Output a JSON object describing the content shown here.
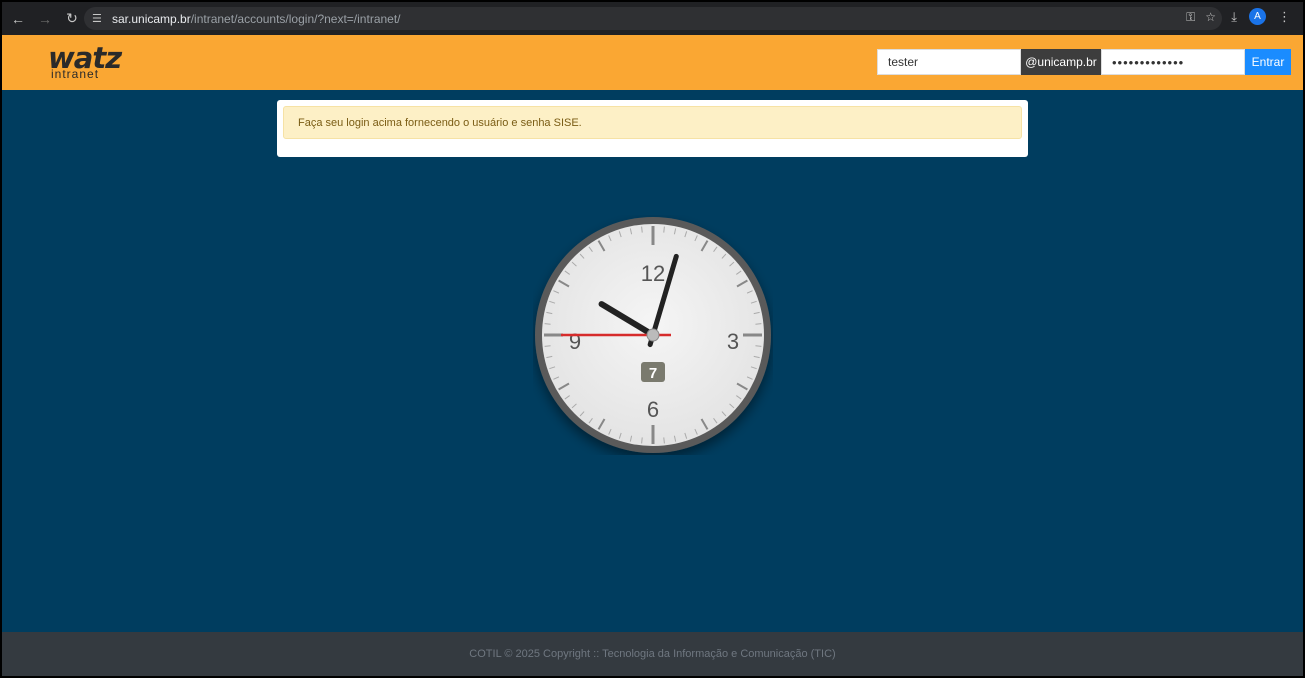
{
  "browser": {
    "url_host": "sar.unicamp.br",
    "url_path": "/intranet/accounts/login/?next=/intranet/",
    "profile_initial": "A"
  },
  "header": {
    "logo_main": "watz",
    "logo_sub": "intranet",
    "username_value": "tester",
    "domain_suffix": "@unicamp.br",
    "password_value": "•••••••••••••",
    "submit_label": "Entrar"
  },
  "alert": {
    "message": "Faça seu login acima fornecendo o usuário e senha SISE."
  },
  "clock": {
    "numerals": [
      "12",
      "3",
      "6",
      "9"
    ],
    "date_badge": "7",
    "hours": 10,
    "minutes": 2,
    "seconds": 45
  },
  "footer": {
    "text": "COTIL © 2025 Copyright :: Tecnologia da Informação e Comunicação (TIC)"
  },
  "colors": {
    "header_bg": "#faa733",
    "page_bg": "#003d5f",
    "button_primary": "#1a8cff",
    "footer_bg": "#343a40",
    "second_hand": "#d62b2b"
  }
}
